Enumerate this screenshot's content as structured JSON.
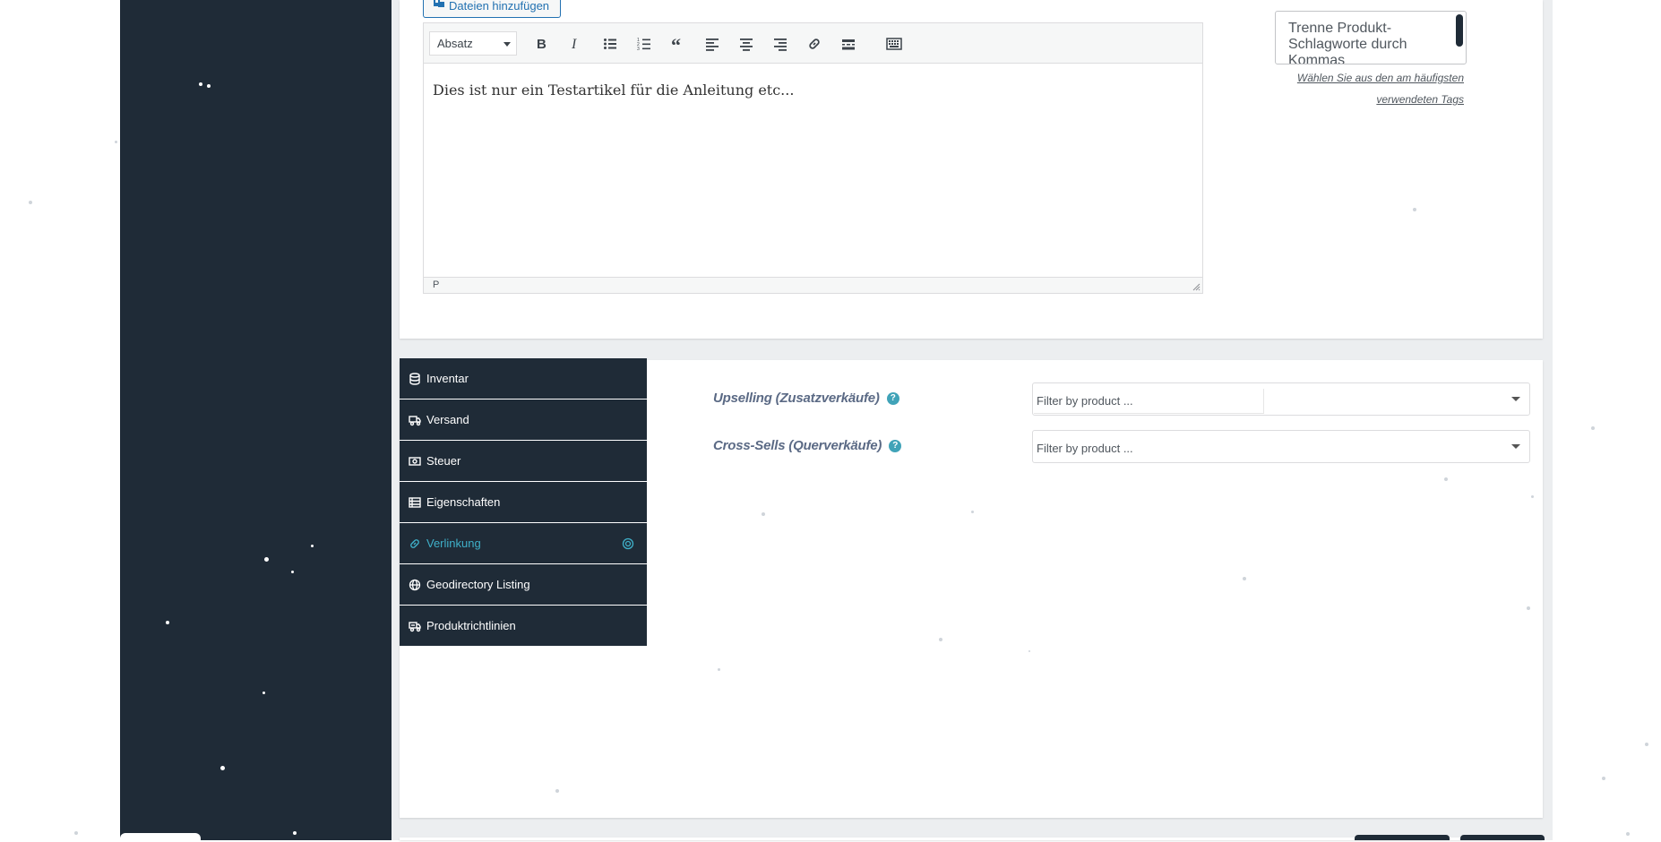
{
  "editor": {
    "add_media_label": "Dateien hinzufügen",
    "format_value": "Absatz",
    "toolbar_icons": [
      "bold-icon",
      "italic-icon",
      "bullet-list-icon",
      "numbered-list-icon",
      "blockquote-icon",
      "align-left-icon",
      "align-center-icon",
      "align-right-icon",
      "link-icon",
      "read-more-icon",
      "toolbar-toggle-icon"
    ],
    "content": "Dies ist nur ein Testartikel für die Anleitung etc...",
    "path": "P"
  },
  "tags": {
    "placeholder": "Trenne Produkt-Schlagworte durch Kommas",
    "choose_link": "Wählen Sie aus den am häufigsten verwendeten Tags"
  },
  "product_data_tabs": [
    {
      "label": "Inventar",
      "icon": "database-icon"
    },
    {
      "label": "Versand",
      "icon": "truck-icon"
    },
    {
      "label": "Steuer",
      "icon": "money-icon"
    },
    {
      "label": "Eigenschaften",
      "icon": "list-icon"
    },
    {
      "label": "Verlinkung",
      "icon": "link-icon",
      "active": true
    },
    {
      "label": "Geodirectory Listing",
      "icon": "globe-icon"
    },
    {
      "label": "Produktrichtlinien",
      "icon": "shipping-policy-icon"
    }
  ],
  "linked_products": {
    "upsells_label": "Upselling (Zusatzverkäufe)",
    "upsells_placeholder": "Filter by product ...",
    "crosssells_label": "Cross-Sells (Querverkäufe)",
    "crosssells_placeholder": "Filter by product ...",
    "help_glyph": "?"
  },
  "colors": {
    "sidebar": "#1f2b37",
    "accent": "#3fb0c9",
    "link": "#2271b1"
  }
}
